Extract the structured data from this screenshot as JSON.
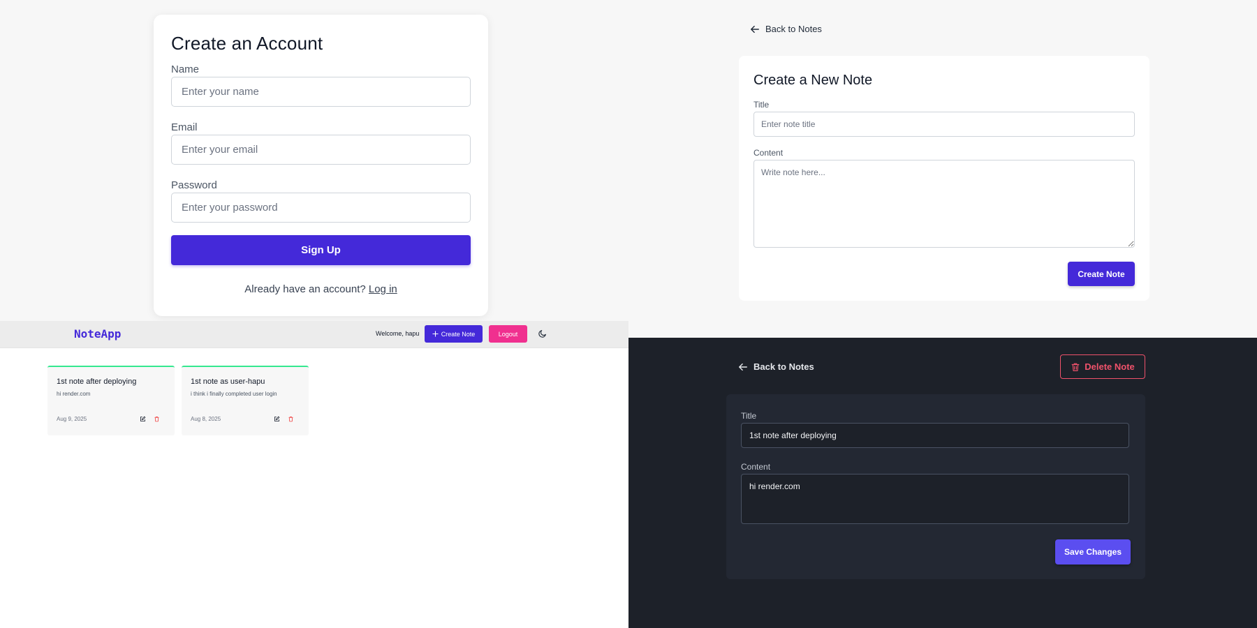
{
  "signup": {
    "title": "Create an Account",
    "name_label": "Name",
    "name_placeholder": "Enter your name",
    "email_label": "Email",
    "email_placeholder": "Enter your email",
    "password_label": "Password",
    "password_placeholder": "Enter your password",
    "submit_label": "Sign Up",
    "footer_text": "Already have an account?",
    "login_link": "Log in"
  },
  "create_note": {
    "back_label": "Back to Notes",
    "title": "Create a New Note",
    "title_label": "Title",
    "title_placeholder": "Enter note title",
    "content_label": "Content",
    "content_placeholder": "Write note here...",
    "submit_label": "Create Note"
  },
  "notes_list": {
    "brand": "NoteApp",
    "welcome": "Welcome, hapu",
    "create_label": "Create Note",
    "logout_label": "Logout",
    "notes": [
      {
        "title": "1st note after deploying",
        "content": "hi render.com",
        "date": "Aug 9, 2025"
      },
      {
        "title": "1st note as user-hapu",
        "content": "i think i finally completed user login",
        "date": "Aug 8, 2025"
      }
    ]
  },
  "edit_note": {
    "back_label": "Back to Notes",
    "delete_label": "Delete Note",
    "title_label": "Title",
    "title_value": "1st note after deploying",
    "content_label": "Content",
    "content_value": "hi render.com",
    "save_label": "Save Changes"
  },
  "colors": {
    "primary": "#4429d9",
    "logout": "#f0308f",
    "card_accent": "#34e88f",
    "delete": "#f0526b",
    "dark_bg": "#1d2129"
  }
}
